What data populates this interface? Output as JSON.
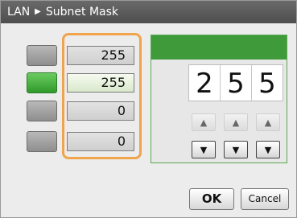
{
  "title": {
    "parent": "LAN",
    "separator_icon": "triangle-right-icon",
    "current": "Subnet Mask"
  },
  "octets": [
    {
      "value": "255",
      "active": false
    },
    {
      "value": "255",
      "active": true
    },
    {
      "value": "0",
      "active": false
    },
    {
      "value": "0",
      "active": false
    }
  ],
  "editor": {
    "digits": [
      "2",
      "5",
      "5"
    ],
    "up_icon": "▲",
    "down_icon": "▼"
  },
  "buttons": {
    "ok": "OK",
    "cancel": "Cancel"
  },
  "colors": {
    "accent_green": "#3f9b3a",
    "highlight_orange": "#f0a44c"
  }
}
